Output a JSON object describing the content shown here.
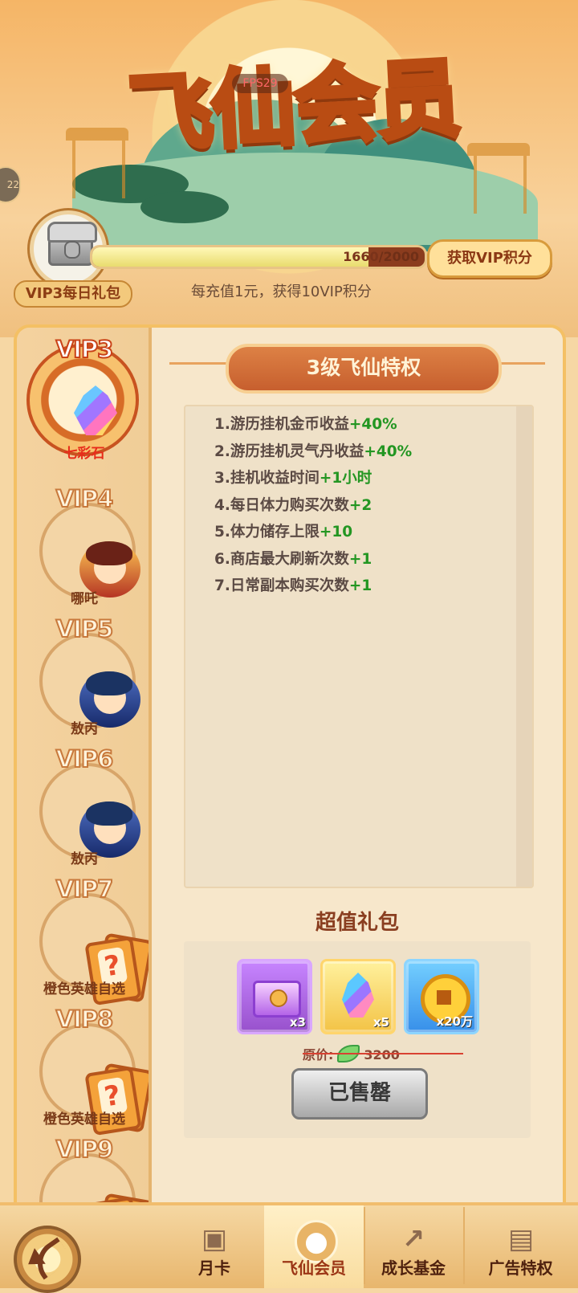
{
  "header": {
    "title": "飞仙会员",
    "fps": "FPS29",
    "left_badge": "22",
    "gift_label": "VIP3每日礼包",
    "progress": {
      "current": 1660,
      "max": 2000,
      "text_current": "1660",
      "text_total": "/2000",
      "ratio": 0.83
    },
    "get_points_button": "获取VIP积分",
    "hint": "每充值1元，获得10VIP积分"
  },
  "sidebar": {
    "items": [
      {
        "level": "VIP3",
        "name": "七彩石",
        "icon": "rainbow-crystal-icon",
        "active": true
      },
      {
        "level": "VIP4",
        "name": "哪吒",
        "icon": "nezha-avatar"
      },
      {
        "level": "VIP5",
        "name": "敖丙",
        "icon": "aobing-avatar"
      },
      {
        "level": "VIP6",
        "name": "敖丙",
        "icon": "aobing-avatar"
      },
      {
        "level": "VIP7",
        "name": "橙色英雄自选",
        "icon": "orange-hero-choice-card-icon"
      },
      {
        "level": "VIP8",
        "name": "橙色英雄自选",
        "icon": "orange-hero-choice-card-icon"
      },
      {
        "level": "VIP9",
        "name": "",
        "icon": "orange-hero-choice-card-icon"
      }
    ]
  },
  "privileges": {
    "title": "3级飞仙特权",
    "items": [
      {
        "text": "1.游历挂机金币收益",
        "bonus": "+40%"
      },
      {
        "text": "2.游历挂机灵气丹收益",
        "bonus": "+40%"
      },
      {
        "text": "3.挂机收益时间",
        "bonus": "+1小时"
      },
      {
        "text": "4.每日体力购买次数",
        "bonus": "+2"
      },
      {
        "text": "5.体力储存上限",
        "bonus": "+10"
      },
      {
        "text": "6.商店最大刷新次数",
        "bonus": "+1"
      },
      {
        "text": "7.日常副本购买次数",
        "bonus": "+1"
      }
    ]
  },
  "gift_pack": {
    "title": "超值礼包",
    "rewards": [
      {
        "count": "x3",
        "icon": "treasure-chest-icon"
      },
      {
        "count": "x5",
        "icon": "rainbow-crystal-icon"
      },
      {
        "count": "x20万",
        "icon": "gold-coin-icon"
      }
    ],
    "price_label": "原价:",
    "price_value": "3200",
    "button": "已售罄"
  },
  "bottom_tabs": [
    {
      "label": "月卡",
      "icon": "month-card-icon"
    },
    {
      "label": "飞仙会员",
      "icon": "gourd-icon",
      "active": true
    },
    {
      "label": "成长基金",
      "icon": "growth-chart-icon"
    },
    {
      "label": "广告特权",
      "icon": "ad-card-icon"
    }
  ],
  "colors": {
    "accent": "#c75f2e",
    "bonus_green": "#239622",
    "panel": "#f7e7cb"
  }
}
